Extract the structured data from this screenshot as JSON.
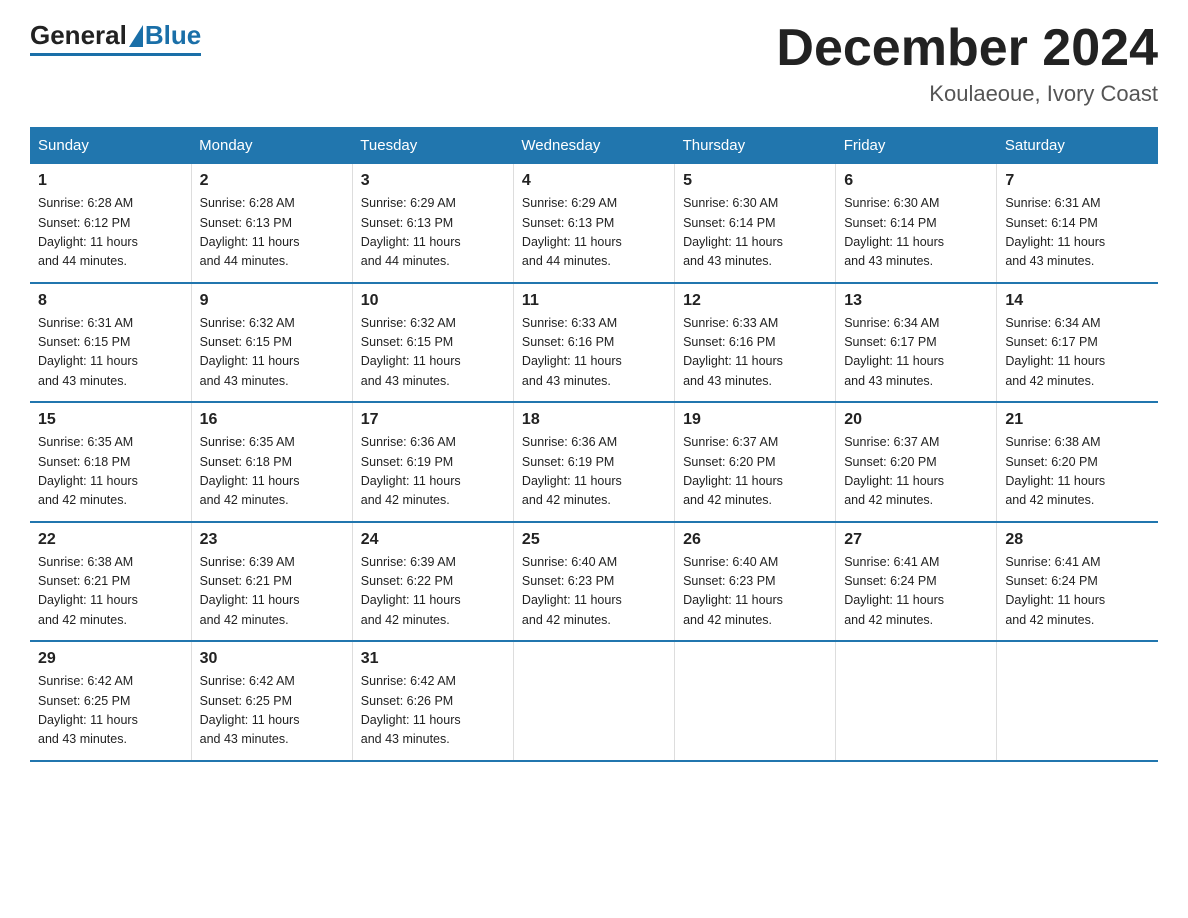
{
  "logo": {
    "general": "General",
    "blue": "Blue"
  },
  "header": {
    "month": "December 2024",
    "location": "Koulaeoue, Ivory Coast"
  },
  "weekdays": [
    "Sunday",
    "Monday",
    "Tuesday",
    "Wednesday",
    "Thursday",
    "Friday",
    "Saturday"
  ],
  "weeks": [
    [
      {
        "day": "1",
        "sunrise": "6:28 AM",
        "sunset": "6:12 PM",
        "daylight": "11 hours and 44 minutes."
      },
      {
        "day": "2",
        "sunrise": "6:28 AM",
        "sunset": "6:13 PM",
        "daylight": "11 hours and 44 minutes."
      },
      {
        "day": "3",
        "sunrise": "6:29 AM",
        "sunset": "6:13 PM",
        "daylight": "11 hours and 44 minutes."
      },
      {
        "day": "4",
        "sunrise": "6:29 AM",
        "sunset": "6:13 PM",
        "daylight": "11 hours and 44 minutes."
      },
      {
        "day": "5",
        "sunrise": "6:30 AM",
        "sunset": "6:14 PM",
        "daylight": "11 hours and 43 minutes."
      },
      {
        "day": "6",
        "sunrise": "6:30 AM",
        "sunset": "6:14 PM",
        "daylight": "11 hours and 43 minutes."
      },
      {
        "day": "7",
        "sunrise": "6:31 AM",
        "sunset": "6:14 PM",
        "daylight": "11 hours and 43 minutes."
      }
    ],
    [
      {
        "day": "8",
        "sunrise": "6:31 AM",
        "sunset": "6:15 PM",
        "daylight": "11 hours and 43 minutes."
      },
      {
        "day": "9",
        "sunrise": "6:32 AM",
        "sunset": "6:15 PM",
        "daylight": "11 hours and 43 minutes."
      },
      {
        "day": "10",
        "sunrise": "6:32 AM",
        "sunset": "6:15 PM",
        "daylight": "11 hours and 43 minutes."
      },
      {
        "day": "11",
        "sunrise": "6:33 AM",
        "sunset": "6:16 PM",
        "daylight": "11 hours and 43 minutes."
      },
      {
        "day": "12",
        "sunrise": "6:33 AM",
        "sunset": "6:16 PM",
        "daylight": "11 hours and 43 minutes."
      },
      {
        "day": "13",
        "sunrise": "6:34 AM",
        "sunset": "6:17 PM",
        "daylight": "11 hours and 43 minutes."
      },
      {
        "day": "14",
        "sunrise": "6:34 AM",
        "sunset": "6:17 PM",
        "daylight": "11 hours and 42 minutes."
      }
    ],
    [
      {
        "day": "15",
        "sunrise": "6:35 AM",
        "sunset": "6:18 PM",
        "daylight": "11 hours and 42 minutes."
      },
      {
        "day": "16",
        "sunrise": "6:35 AM",
        "sunset": "6:18 PM",
        "daylight": "11 hours and 42 minutes."
      },
      {
        "day": "17",
        "sunrise": "6:36 AM",
        "sunset": "6:19 PM",
        "daylight": "11 hours and 42 minutes."
      },
      {
        "day": "18",
        "sunrise": "6:36 AM",
        "sunset": "6:19 PM",
        "daylight": "11 hours and 42 minutes."
      },
      {
        "day": "19",
        "sunrise": "6:37 AM",
        "sunset": "6:20 PM",
        "daylight": "11 hours and 42 minutes."
      },
      {
        "day": "20",
        "sunrise": "6:37 AM",
        "sunset": "6:20 PM",
        "daylight": "11 hours and 42 minutes."
      },
      {
        "day": "21",
        "sunrise": "6:38 AM",
        "sunset": "6:20 PM",
        "daylight": "11 hours and 42 minutes."
      }
    ],
    [
      {
        "day": "22",
        "sunrise": "6:38 AM",
        "sunset": "6:21 PM",
        "daylight": "11 hours and 42 minutes."
      },
      {
        "day": "23",
        "sunrise": "6:39 AM",
        "sunset": "6:21 PM",
        "daylight": "11 hours and 42 minutes."
      },
      {
        "day": "24",
        "sunrise": "6:39 AM",
        "sunset": "6:22 PM",
        "daylight": "11 hours and 42 minutes."
      },
      {
        "day": "25",
        "sunrise": "6:40 AM",
        "sunset": "6:23 PM",
        "daylight": "11 hours and 42 minutes."
      },
      {
        "day": "26",
        "sunrise": "6:40 AM",
        "sunset": "6:23 PM",
        "daylight": "11 hours and 42 minutes."
      },
      {
        "day": "27",
        "sunrise": "6:41 AM",
        "sunset": "6:24 PM",
        "daylight": "11 hours and 42 minutes."
      },
      {
        "day": "28",
        "sunrise": "6:41 AM",
        "sunset": "6:24 PM",
        "daylight": "11 hours and 42 minutes."
      }
    ],
    [
      {
        "day": "29",
        "sunrise": "6:42 AM",
        "sunset": "6:25 PM",
        "daylight": "11 hours and 43 minutes."
      },
      {
        "day": "30",
        "sunrise": "6:42 AM",
        "sunset": "6:25 PM",
        "daylight": "11 hours and 43 minutes."
      },
      {
        "day": "31",
        "sunrise": "6:42 AM",
        "sunset": "6:26 PM",
        "daylight": "11 hours and 43 minutes."
      },
      null,
      null,
      null,
      null
    ]
  ],
  "labels": {
    "sunrise": "Sunrise:",
    "sunset": "Sunset:",
    "daylight": "Daylight:"
  }
}
